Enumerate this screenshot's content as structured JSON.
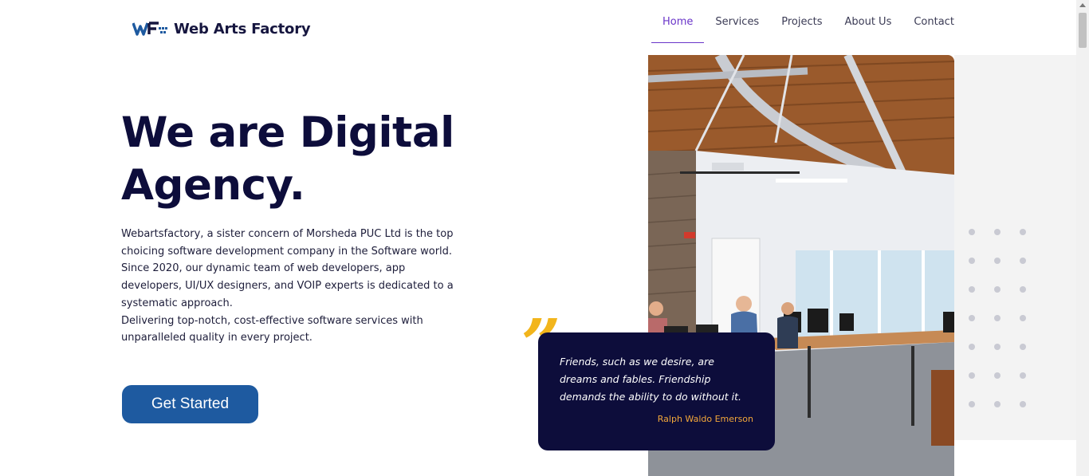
{
  "brand": {
    "name": "Web Arts Factory",
    "logo_letters": "WF"
  },
  "nav": {
    "items": [
      {
        "label": "Home",
        "active": true
      },
      {
        "label": "Services",
        "active": false
      },
      {
        "label": "Projects",
        "active": false
      },
      {
        "label": "About Us",
        "active": false
      },
      {
        "label": "Contact",
        "active": false
      }
    ]
  },
  "hero": {
    "title_line1": "We are Digital",
    "title_line2": "Agency.",
    "description_1": "Webartsfactory, a sister concern of Morsheda PUC Ltd is the top choicing software development company in the Software world. Since 2020, our dynamic team of web developers, app developers, UI/UX designers, and VOIP experts is dedicated to a systematic approach.",
    "description_2": "Delivering top-notch, cost-effective software services with unparalleled quality in every project.",
    "cta_label": "Get Started"
  },
  "quote": {
    "mark": "”",
    "text": "Friends, such as we desire, are dreams and fables. Friendship demands the ability to do without it.",
    "author": "Ralph Waldo Emerson"
  },
  "image": {
    "name": "office-photo",
    "description_icon": "office-interior-image"
  },
  "colors": {
    "brand_navy": "#0d0d3b",
    "accent_purple": "#6a35c9",
    "cta_blue": "#1e5aa0",
    "quote_yellow": "#f2b51c",
    "author_orange": "#f2a73a"
  }
}
